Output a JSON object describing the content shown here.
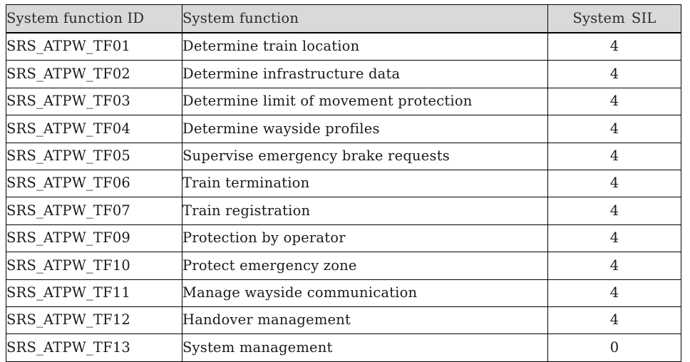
{
  "table": {
    "columns": [
      {
        "key": "id",
        "label": "System function ID"
      },
      {
        "key": "func",
        "label": "System function"
      },
      {
        "key": "sil",
        "label_part1": "System",
        "label_part2": "SIL",
        "label": "System  SIL"
      }
    ],
    "rows": [
      {
        "id": "SRS_ATPW_TF01",
        "func": "Determine train location",
        "sil": "4"
      },
      {
        "id": "SRS_ATPW_TF02",
        "func": "Determine infrastructure data",
        "sil": "4"
      },
      {
        "id": "SRS_ATPW_TF03",
        "func": "Determine limit of movement protection",
        "sil": "4"
      },
      {
        "id": "SRS_ATPW_TF04",
        "func": "Determine wayside profiles",
        "sil": "4"
      },
      {
        "id": "SRS_ATPW_TF05",
        "func": "Supervise emergency brake requests",
        "sil": "4"
      },
      {
        "id": "SRS_ATPW_TF06",
        "func": "Train termination",
        "sil": "4"
      },
      {
        "id": "SRS_ATPW_TF07",
        "func": "Train registration",
        "sil": "4"
      },
      {
        "id": "SRS_ATPW_TF09",
        "func": "Protection by operator",
        "sil": "4"
      },
      {
        "id": "SRS_ATPW_TF10",
        "func": "Protect emergency zone",
        "sil": "4"
      },
      {
        "id": "SRS_ATPW_TF11",
        "func": "Manage wayside communication",
        "sil": "4"
      },
      {
        "id": "SRS_ATPW_TF12",
        "func": "Handover management",
        "sil": "4"
      },
      {
        "id": "SRS_ATPW_TF13",
        "func": "System management",
        "sil": "0"
      }
    ]
  },
  "colors": {
    "header_background": "#d9d9d9",
    "border": "#000000",
    "text": "#1a1a1a",
    "page_background": "#ffffff"
  }
}
